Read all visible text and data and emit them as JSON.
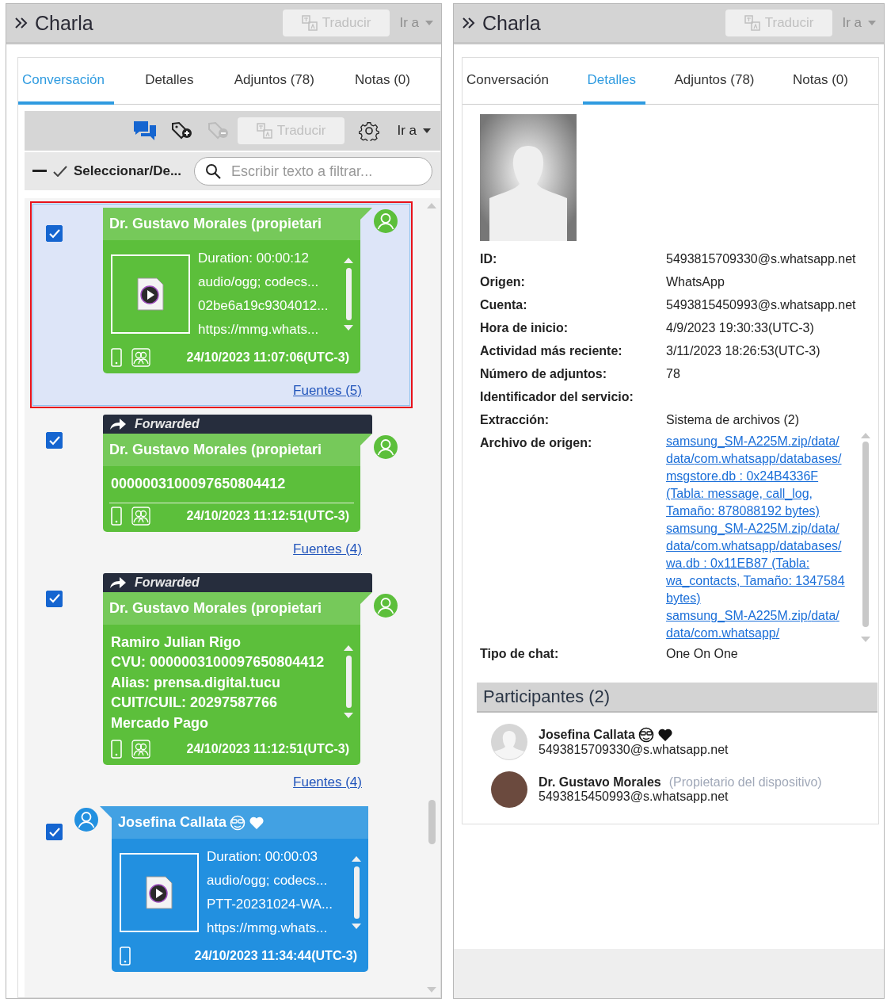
{
  "left_panel": {
    "title": "Charla",
    "header_translate": {
      "label": "Traducir",
      "disabled": true
    },
    "header_goto": {
      "label": "Ir a",
      "disabled": true
    },
    "tabs": [
      {
        "label": "Conversación",
        "selected": true
      },
      {
        "label": "Detalles",
        "selected": false
      },
      {
        "label": "Adjuntos (78)",
        "selected": false
      },
      {
        "label": "Notas (0)",
        "selected": false
      }
    ],
    "toolbar": {
      "tag_remove_disabled": true,
      "translate": {
        "label": "Traducir",
        "disabled": true
      },
      "goto": {
        "label": "Ir a",
        "disabled": false
      }
    },
    "select_toggle": "Seleccionar/De...",
    "filter": {
      "placeholder": "Escribir texto a filtrar..."
    },
    "messages": [
      {
        "kind": "outgoing",
        "checked": true,
        "selected": true,
        "sender": "Dr. Gustavo Morales (propietari",
        "emoji": false,
        "attachment": [
          "Duration: 00:00:12",
          "audio/ogg; codecs...",
          "02be6a19c9304012...",
          "https://mmg.whats..."
        ],
        "timestamp": "24/10/2023 11:07:06(UTC-3)",
        "sources": "Fuentes (5)"
      },
      {
        "kind": "outgoing",
        "checked": true,
        "selected": false,
        "forwarded_label": "Forwarded",
        "sender": "Dr. Gustavo Morales (propietari",
        "emoji": false,
        "text": [
          "0000003100097650804412"
        ],
        "scrollable": false,
        "timestamp": "24/10/2023 11:12:51(UTC-3)",
        "sources": "Fuentes (4)"
      },
      {
        "kind": "outgoing",
        "checked": true,
        "selected": false,
        "forwarded_label": "Forwarded",
        "sender": "Dr. Gustavo Morales (propietari",
        "emoji": false,
        "text": [
          "Ramiro Julian Rigo",
          "CVU: 0000003100097650804412",
          "Alias: prensa.digital.tucu",
          "CUIT/CUIL: 20297587766",
          "Mercado Pago"
        ],
        "scrollable": true,
        "timestamp": "24/10/2023 11:12:51(UTC-3)",
        "sources": "Fuentes (4)"
      },
      {
        "kind": "incoming",
        "checked": true,
        "selected": false,
        "sender": "Josefina Callata",
        "emoji": true,
        "attachment": [
          "Duration: 00:00:03",
          "audio/ogg; codecs...",
          "PTT-20231024-WA...",
          "https://mmg.whats..."
        ],
        "timestamp": "24/10/2023 11:34:44(UTC-3)"
      }
    ]
  },
  "right_panel": {
    "title": "Charla",
    "header_translate": {
      "label": "Traducir",
      "disabled": true
    },
    "header_goto": {
      "label": "Ir a",
      "disabled": true
    },
    "tabs": [
      {
        "label": "Conversación",
        "selected": false
      },
      {
        "label": "Detalles",
        "selected": true
      },
      {
        "label": "Adjuntos (78)",
        "selected": false
      },
      {
        "label": "Notas (0)",
        "selected": false
      }
    ],
    "details": [
      {
        "kind": "text",
        "label": "ID:",
        "value": "5493815709330@s.whatsapp.net"
      },
      {
        "kind": "text",
        "label": "Origen:",
        "value": "WhatsApp"
      },
      {
        "kind": "text",
        "label": "Cuenta:",
        "value": "5493815450993@s.whatsapp.net"
      },
      {
        "kind": "text",
        "label": "Hora de inicio:",
        "value": "4/9/2023 19:30:33(UTC-3)"
      },
      {
        "kind": "text",
        "label": "Actividad más reciente:",
        "value": "3/11/2023 18:26:53(UTC-3)"
      },
      {
        "kind": "text",
        "label": "Número de adjuntos:",
        "value": "78"
      },
      {
        "kind": "text",
        "label": "Identificador del servicio:"
      },
      {
        "kind": "text",
        "label": "Extracción:",
        "value": "Sistema de archivos (2)"
      },
      {
        "kind": "links",
        "label": "Archivo de origen:",
        "links": [
          "samsung_SM-A225M.zip/data/data/com.whatsapp/databases/msgstore.db : 0x24B4336F (Tabla: message, call_log, Tamaño: 878088192 bytes)",
          "samsung_SM-A225M.zip/data/data/com.whatsapp/databases/wa.db : 0x11EB87 (Tabla: wa_contacts, Tamaño: 1347584 bytes)",
          "samsung_SM-A225M.zip/data/data/com.whatsapp/"
        ]
      },
      {
        "kind": "text",
        "label": "Tipo de chat:",
        "value": "One On One"
      }
    ],
    "participants": {
      "title": "Participantes (2)",
      "items": [
        {
          "kind": "silhouette",
          "name": "Josefina Callata",
          "emoji": true,
          "id": "5493815709330@s.whatsapp.net"
        },
        {
          "kind": "photo",
          "name": "Dr. Gustavo Morales",
          "role": "(Propietario del dispositivo)",
          "emoji": false,
          "id": "5493815450993@s.whatsapp.net"
        }
      ]
    }
  }
}
